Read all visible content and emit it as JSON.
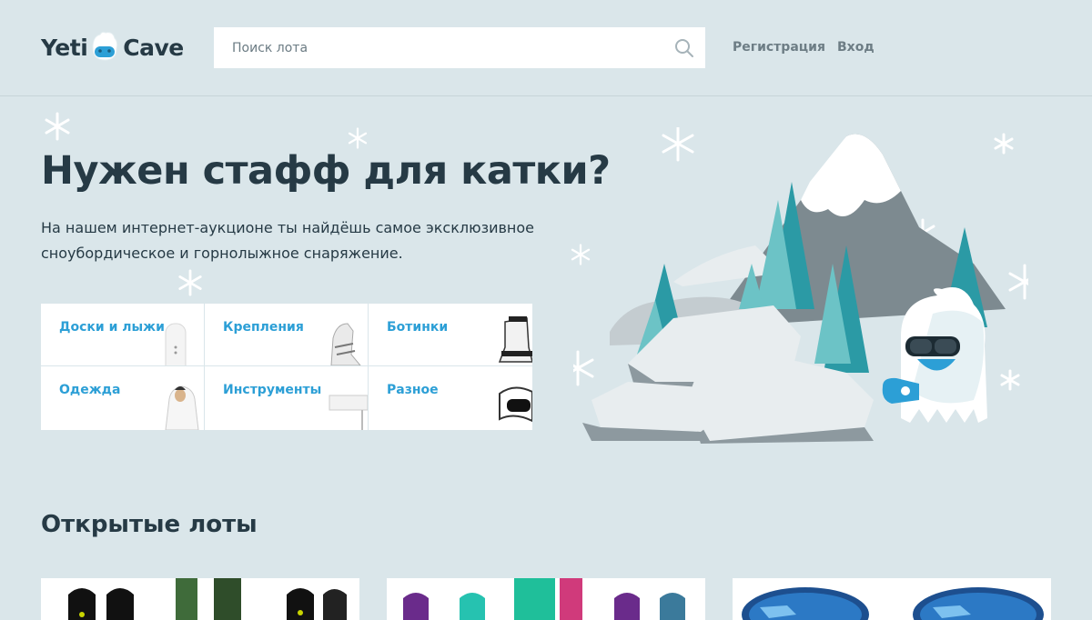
{
  "header": {
    "logo_left": "Yeti",
    "logo_right": "Cave",
    "search_placeholder": "Поиск лота",
    "register_label": "Регистрация",
    "login_label": "Вход"
  },
  "promo": {
    "title": "Нужен стафф для катки?",
    "text": "На нашем интернет-аукционе ты найдёшь самое эксклюзивное сноубордическое и горнолыжное снаряжение."
  },
  "categories": [
    {
      "label": "Доски и лыжи",
      "icon": "snowboard-image"
    },
    {
      "label": "Крепления",
      "icon": "bindings-image"
    },
    {
      "label": "Ботинки",
      "icon": "boots-image"
    },
    {
      "label": "Одежда",
      "icon": "clothing-image"
    },
    {
      "label": "Инструменты",
      "icon": "tools-image"
    },
    {
      "label": "Разное",
      "icon": "goggles-image"
    }
  ],
  "lots": {
    "title": "Открытые лоты"
  },
  "colors": {
    "background": "#dae6ea",
    "text": "#263a45",
    "accent": "#2c9fd6",
    "nav": "#6d7d85"
  }
}
